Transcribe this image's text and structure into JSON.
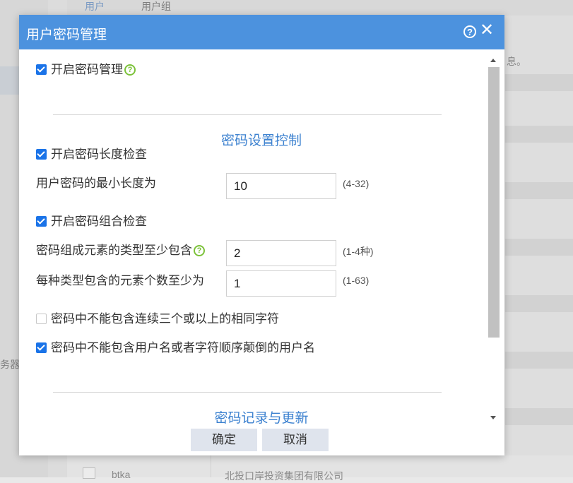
{
  "background": {
    "tabs": [
      "用户",
      "用户组"
    ],
    "note_fragment": "息。",
    "left_fragment": "务器",
    "bottom_row": [
      "btka",
      "北投口岸投资集团有限公司"
    ]
  },
  "dialog": {
    "title": "用户密码管理",
    "enable_password_mgmt": "开启密码管理",
    "section1": "密码设置控制",
    "enable_length_check": "开启密码长度检查",
    "min_length_label": "用户密码的最小长度为",
    "min_length_value": "10",
    "min_length_range": "(4-32)",
    "enable_combo_check": "开启密码组合检查",
    "element_types_label": "密码组成元素的类型至少包含",
    "element_types_value": "2",
    "element_types_range": "(1-4种)",
    "per_type_label": "每种类型包含的元素个数至少为",
    "per_type_value": "1",
    "per_type_range": "(1-63)",
    "no_three_same": "密码中不能包含连续三个或以上的相同字符",
    "no_username": "密码中不能包含用户名或者字符顺序颠倒的用户名",
    "section2": "密码记录与更新",
    "ok": "确定",
    "cancel": "取消"
  },
  "colors": {
    "titlebar": "#4c92de",
    "section": "#3d82d0",
    "checkbox": "#1a73e8",
    "help_green": "#7cc23a"
  },
  "icons": [
    "help-icon",
    "close-icon",
    "question-icon"
  ]
}
